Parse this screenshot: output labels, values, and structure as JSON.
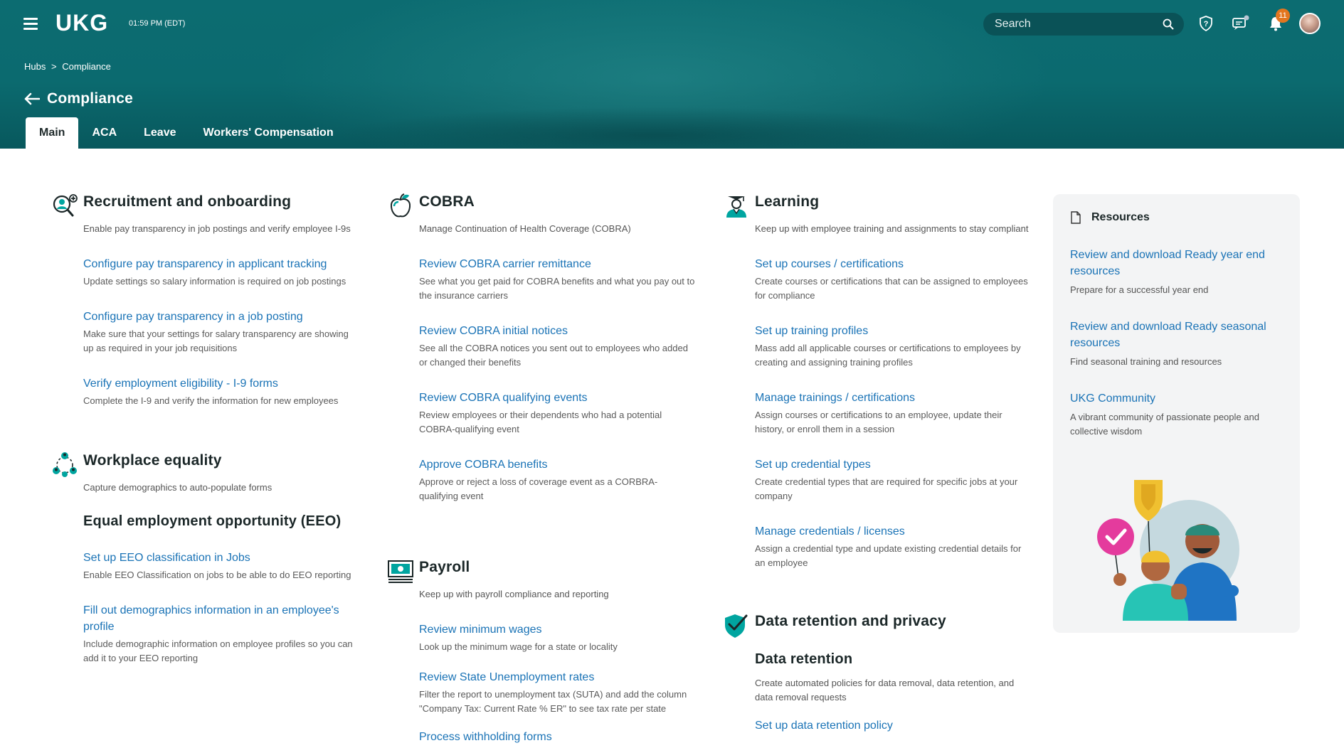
{
  "header": {
    "logo": "UKG",
    "time": "01:59 PM (EDT)",
    "search_placeholder": "Search",
    "notification_count": "11"
  },
  "breadcrumb": {
    "hubs": "Hubs",
    "separator": ">",
    "current": "Compliance"
  },
  "page_title": "Compliance",
  "tabs": [
    {
      "label": "Main",
      "active": true
    },
    {
      "label": "ACA",
      "active": false
    },
    {
      "label": "Leave",
      "active": false
    },
    {
      "label": "Workers' Compensation",
      "active": false
    }
  ],
  "col1": {
    "recruitment": {
      "title": "Recruitment and onboarding",
      "desc": "Enable pay transparency in job postings and verify employee I-9s",
      "items": [
        {
          "link": "Configure pay transparency in applicant tracking",
          "desc": "Update settings so salary information is required on job postings"
        },
        {
          "link": "Configure pay transparency in a job posting",
          "desc": "Make sure that your settings for salary transparency are showing up as required in your job requisitions"
        },
        {
          "link": "Verify employment eligibility - I-9 forms",
          "desc": "Complete the I-9 and verify the information for new employees"
        }
      ]
    },
    "equality": {
      "title": "Workplace equality",
      "desc": "Capture demographics to auto-populate forms",
      "subhead": "Equal employment opportunity (EEO)",
      "items": [
        {
          "link": "Set up EEO classification in Jobs",
          "desc": "Enable EEO Classification on jobs to be able to do EEO reporting"
        },
        {
          "link": "Fill out demographics information in an employee's profile",
          "desc": "Include demographic information on employee profiles so you can add it to your EEO reporting"
        }
      ]
    }
  },
  "col2": {
    "cobra": {
      "title": "COBRA",
      "desc": "Manage Continuation of Health Coverage (COBRA)",
      "items": [
        {
          "link": "Review COBRA carrier remittance",
          "desc": "See what you get paid for COBRA benefits and what you pay out to the insurance carriers"
        },
        {
          "link": "Review COBRA initial notices",
          "desc": "See all the COBRA notices you sent out to employees who added or changed their benefits"
        },
        {
          "link": "Review COBRA qualifying events",
          "desc": "Review employees or their dependents who had a potential COBRA-qualifying event"
        },
        {
          "link": "Approve COBRA benefits",
          "desc": "Approve or reject a loss of coverage event as a CORBRA-qualifying event"
        }
      ]
    },
    "payroll": {
      "title": "Payroll",
      "desc": "Keep up with payroll compliance and reporting",
      "items": [
        {
          "link": "Review minimum wages",
          "desc": "Look up the minimum wage for a state or locality"
        },
        {
          "link": "Review State Unemployment rates",
          "desc": "Filter the report to unemployment tax (SUTA) and add the column \"Company Tax: Current Rate % ER\" to see tax rate per state"
        },
        {
          "link": "Process withholding forms",
          "desc": ""
        }
      ]
    }
  },
  "col3": {
    "learning": {
      "title": "Learning",
      "desc": "Keep up with employee training and assignments to stay compliant",
      "items": [
        {
          "link": "Set up courses / certifications",
          "desc": "Create courses or certifications that can be assigned to employees for compliance"
        },
        {
          "link": "Set up training profiles",
          "desc": "Mass add all applicable courses or certifications to employees by creating and assigning training profiles"
        },
        {
          "link": "Manage trainings / certifications",
          "desc": "Assign courses or certifications to an employee, update their history, or enroll them in a session"
        },
        {
          "link": "Set up credential types",
          "desc": "Create credential types that are required for specific jobs at your company"
        },
        {
          "link": "Manage credentials / licenses",
          "desc": "Assign a credential type and update existing credential details for an employee"
        }
      ]
    },
    "privacy": {
      "title": "Data retention and privacy",
      "subhead": "Data retention",
      "desc": "Create automated policies for data removal, data retention, and data removal requests",
      "items": [
        {
          "link": "Set up data retention policy",
          "desc": ""
        }
      ]
    }
  },
  "resources": {
    "title": "Resources",
    "items": [
      {
        "link": "Review and download Ready year end resources",
        "desc": "Prepare for a successful year end"
      },
      {
        "link": "Review and download Ready seasonal resources",
        "desc": "Find seasonal training and resources"
      },
      {
        "link": "UKG Community",
        "desc": "A vibrant community of passionate people and collective wisdom"
      }
    ]
  },
  "colors": {
    "header": "#0c6c71",
    "link": "#1a73b6",
    "accent_teal": "#00a5a0",
    "badge": "#e3761f"
  }
}
